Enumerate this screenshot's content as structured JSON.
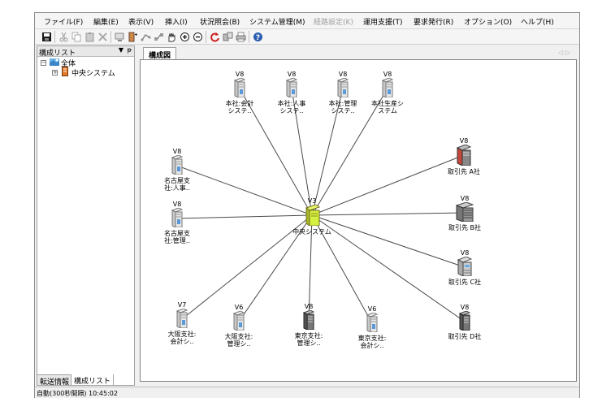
{
  "menu": [
    "ファイル(F)",
    "編集(E)",
    "表示(V)",
    "挿入(I)",
    "状況照会(B)",
    "システム管理(M)",
    "経路設定(K)",
    "運用支援(T)",
    "要求発行(R)",
    "オプション(O)",
    "ヘルプ(H)"
  ],
  "sidebar": {
    "title": "構成リスト",
    "dropdown": "▼",
    "pin": "ᵽ",
    "tree_root": "全体",
    "tree_child": "中央システム"
  },
  "bottom_tabs": [
    "転送情報",
    "構成リスト"
  ],
  "main": {
    "tab": "構成図",
    "tab_arrows": "◁ ▷"
  },
  "center_node": {
    "version": "V3",
    "label": "中央システム"
  },
  "nodes": [
    {
      "version": "V8",
      "label": "本社:会計\nシステ..",
      "style": "gray"
    },
    {
      "version": "V8",
      "label": "本社:人事\nシステ..",
      "style": "gray"
    },
    {
      "version": "V8",
      "label": "本社:管理\nシステ..",
      "style": "gray"
    },
    {
      "version": "V8",
      "label": "本社生産シ\nステム",
      "style": "gray"
    },
    {
      "version": "V8",
      "label": "名古屋支\n社:人事..",
      "style": "gray"
    },
    {
      "version": "V8",
      "label": "名古屋支\n社:管理..",
      "style": "gray"
    },
    {
      "version": "V7",
      "label": "大阪支社:\n会計シ..",
      "style": "gray"
    },
    {
      "version": "V6",
      "label": "大阪支社:\n管理シ..",
      "style": "gray"
    },
    {
      "version": "V8",
      "label": "東京支社:\n管理シ..",
      "style": "dark"
    },
    {
      "version": "V6",
      "label": "東京支社:\n会計シ..",
      "style": "gray"
    },
    {
      "version": "V8",
      "label": "取引先 A社",
      "style": "tower"
    },
    {
      "version": "V8",
      "label": "取引先 B社",
      "style": "rack"
    },
    {
      "version": "V8",
      "label": "取引先 C社",
      "style": "box"
    },
    {
      "version": "V8",
      "label": "取引先 D社",
      "style": "dark"
    }
  ],
  "status": "自動(300秒間隔) 10:45:02"
}
